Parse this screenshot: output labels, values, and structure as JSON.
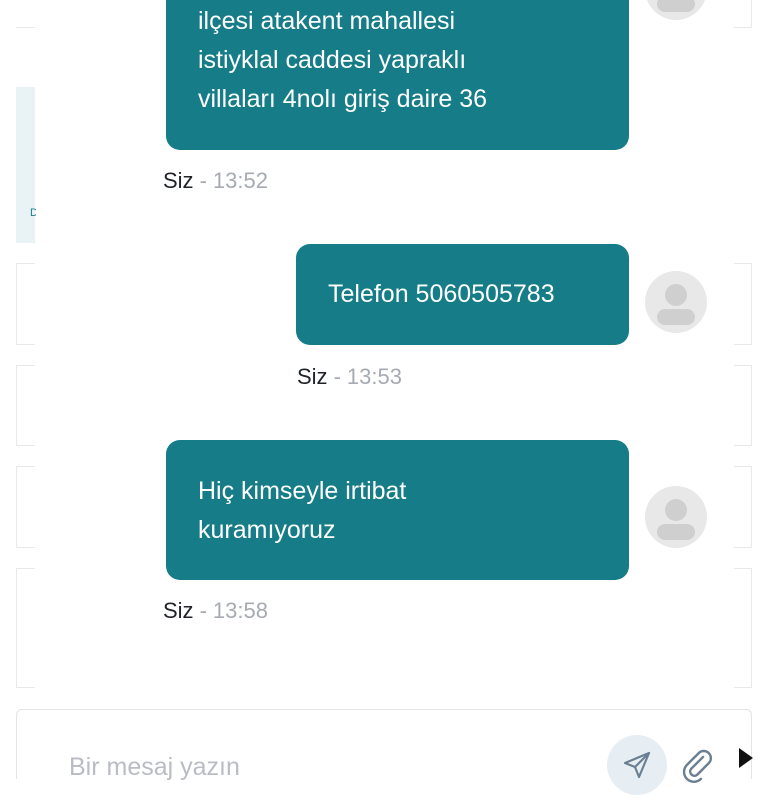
{
  "ghost": {
    "letter": "D"
  },
  "messages": [
    {
      "lines": [
        "ilçesi atakent mahallesi",
        "istiyklal caddesi yapraklı",
        "villaları 4nolı giriş daire 36"
      ],
      "sender": "Siz",
      "separator": "-",
      "time": "13:52",
      "avatar_icon": "user-silhouette-icon"
    },
    {
      "lines": [
        "Telefon 5060505783"
      ],
      "sender": "Siz",
      "separator": "-",
      "time": "13:53",
      "avatar_icon": "user-silhouette-icon"
    },
    {
      "lines": [
        "Hiç kimseyle irtibat",
        "kuramıyoruz"
      ],
      "sender": "Siz",
      "separator": "-",
      "time": "13:58",
      "avatar_icon": "user-silhouette-icon"
    }
  ],
  "composer": {
    "placeholder": "Bir mesaj yazın",
    "send_icon": "send-icon",
    "attach_icon": "paperclip-icon"
  },
  "colors": {
    "bubble": "#167c88",
    "bubble_text": "#ffffff",
    "meta_time": "#a6abb2",
    "avatar_bg": "#e8e8e8"
  }
}
